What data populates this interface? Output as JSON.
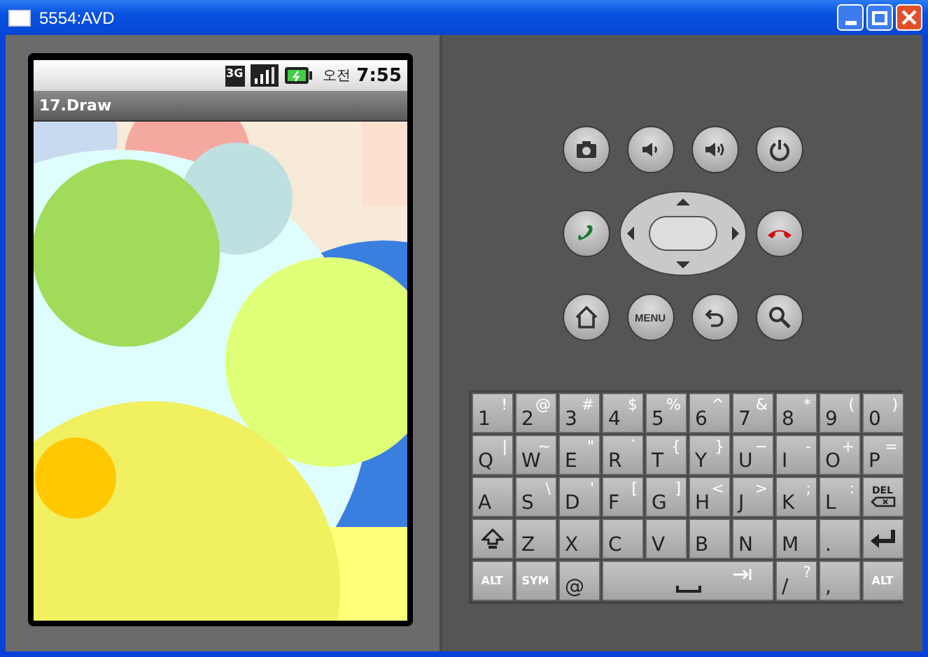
{
  "window": {
    "title": "5554:AVD"
  },
  "phone": {
    "status_bar": {
      "network_label": "3G",
      "time_period": "오전",
      "time": "7:55"
    },
    "app_title": "17.Draw"
  },
  "hardware_buttons": [
    {
      "kind": "camera"
    },
    {
      "kind": "volume-down"
    },
    {
      "kind": "volume-up"
    },
    {
      "kind": "power"
    },
    {
      "kind": "call"
    },
    {
      "kind": "dpad"
    },
    {
      "kind": "end-call"
    },
    {
      "kind": "home"
    },
    {
      "kind": "menu",
      "label": "MENU"
    },
    {
      "kind": "back"
    },
    {
      "kind": "search"
    }
  ],
  "keyboard": {
    "rows": [
      {
        "keys": [
          {
            "kind": "char",
            "label": "1",
            "alt": "!"
          },
          {
            "kind": "char",
            "label": "2",
            "alt": "@"
          },
          {
            "kind": "char",
            "label": "3",
            "alt": "#"
          },
          {
            "kind": "char",
            "label": "4",
            "alt": "$"
          },
          {
            "kind": "char",
            "label": "5",
            "alt": "%"
          },
          {
            "kind": "char",
            "label": "6",
            "alt": "^"
          },
          {
            "kind": "char",
            "label": "7",
            "alt": "&"
          },
          {
            "kind": "char",
            "label": "8",
            "alt": "*"
          },
          {
            "kind": "char",
            "label": "9",
            "alt": "("
          },
          {
            "kind": "char",
            "label": "0",
            "alt": ")"
          }
        ]
      },
      {
        "keys": [
          {
            "kind": "char",
            "label": "Q",
            "alt": "|"
          },
          {
            "kind": "char",
            "label": "W",
            "alt": "~"
          },
          {
            "kind": "char",
            "label": "E",
            "alt": "\""
          },
          {
            "kind": "char",
            "label": "R",
            "alt": "`"
          },
          {
            "kind": "char",
            "label": "T",
            "alt": "{"
          },
          {
            "kind": "char",
            "label": "Y",
            "alt": "}"
          },
          {
            "kind": "char",
            "label": "U",
            "alt": "−"
          },
          {
            "kind": "char",
            "label": "I",
            "alt": "-"
          },
          {
            "kind": "char",
            "label": "O",
            "alt": "+"
          },
          {
            "kind": "char",
            "label": "P",
            "alt": "="
          }
        ]
      },
      {
        "keys": [
          {
            "kind": "char",
            "label": "A"
          },
          {
            "kind": "char",
            "label": "S",
            "alt": "\\"
          },
          {
            "kind": "char",
            "label": "D",
            "alt": "'"
          },
          {
            "kind": "char",
            "label": "F",
            "alt": "["
          },
          {
            "kind": "char",
            "label": "G",
            "alt": "]"
          },
          {
            "kind": "char",
            "label": "H",
            "alt": "<"
          },
          {
            "kind": "char",
            "label": "J",
            "alt": ">"
          },
          {
            "kind": "char",
            "label": "K",
            "alt": ";"
          },
          {
            "kind": "char",
            "label": "L",
            "alt": ":"
          },
          {
            "kind": "delete",
            "label": "DEL"
          }
        ]
      },
      {
        "keys": [
          {
            "kind": "shift"
          },
          {
            "kind": "char",
            "label": "Z"
          },
          {
            "kind": "char",
            "label": "X"
          },
          {
            "kind": "char",
            "label": "C"
          },
          {
            "kind": "char",
            "label": "V"
          },
          {
            "kind": "char",
            "label": "B"
          },
          {
            "kind": "char",
            "label": "N"
          },
          {
            "kind": "char",
            "label": "M"
          },
          {
            "kind": "char",
            "label": "."
          },
          {
            "kind": "enter"
          }
        ]
      },
      {
        "keys": [
          {
            "kind": "mod",
            "label": "ALT"
          },
          {
            "kind": "mod",
            "label": "SYM"
          },
          {
            "kind": "char",
            "label": "@"
          },
          {
            "kind": "space"
          },
          {
            "kind": "char",
            "label": "/",
            "alt": "?"
          },
          {
            "kind": "char",
            "label": ","
          },
          {
            "kind": "mod",
            "label": "ALT"
          }
        ]
      }
    ]
  }
}
